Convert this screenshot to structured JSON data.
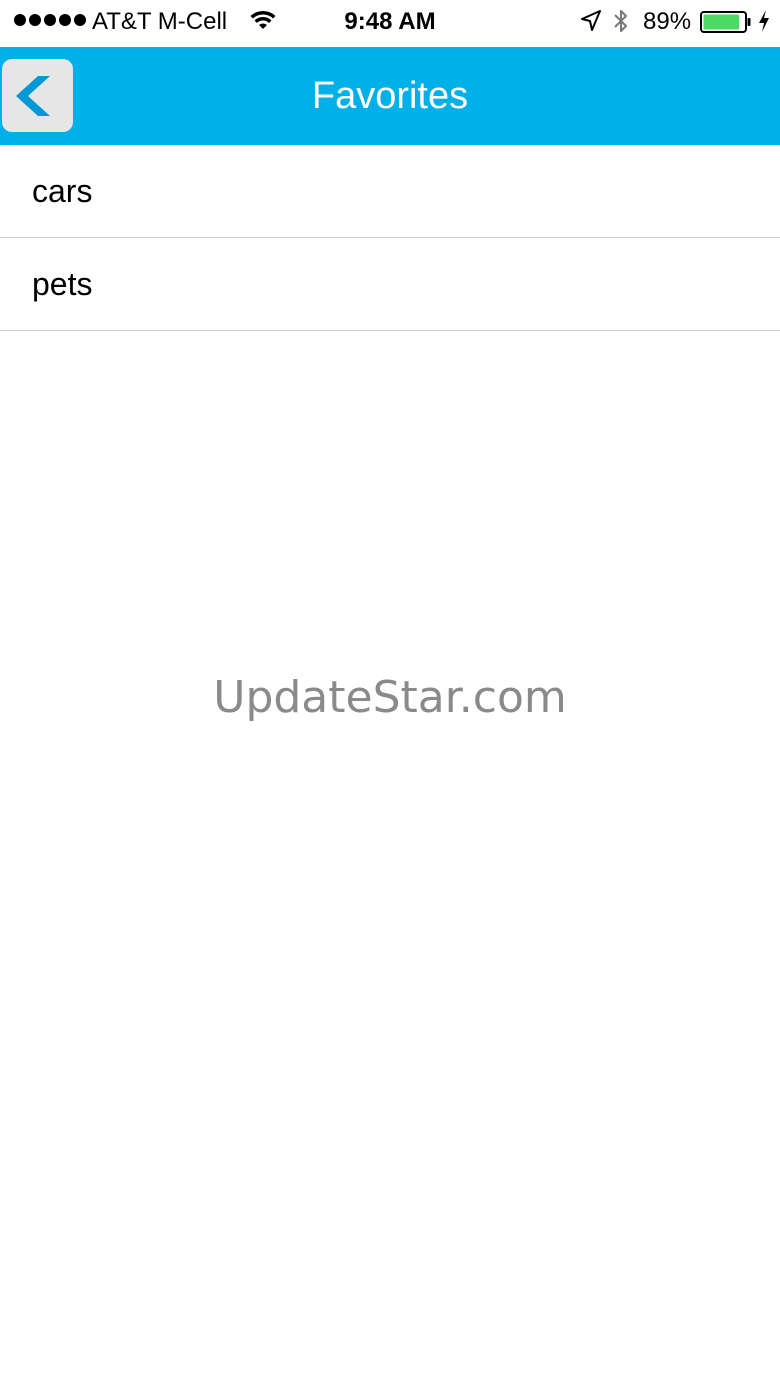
{
  "status_bar": {
    "carrier": "AT&T M-Cell",
    "time": "9:48 AM",
    "battery": "89%",
    "battery_level": 0.89,
    "battery_color": "#4cd964",
    "icons": [
      "signal-dots-icon",
      "wifi-icon",
      "location-icon",
      "bluetooth-icon",
      "battery-icon",
      "charging-icon"
    ]
  },
  "nav": {
    "title": "Favorites",
    "bar_color": "#00b0e6",
    "back_icon": "chevron-left-icon"
  },
  "favorites": {
    "items": [
      {
        "label": "cars"
      },
      {
        "label": "pets"
      }
    ]
  },
  "watermark": "UpdateStar.com"
}
